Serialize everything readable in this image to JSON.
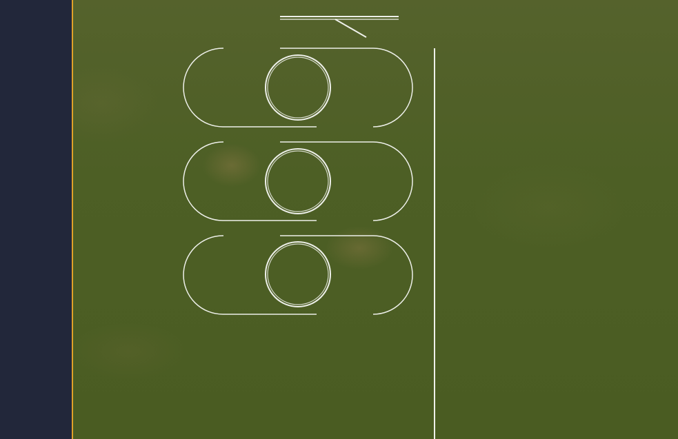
{
  "colors": {
    "sidebar": "#22273a",
    "accent_divider": "#e0a12a",
    "field": "#4d5f25",
    "markings": "#eef0ea"
  },
  "markings": {
    "oval_slots": 3,
    "icons": [
      "toggle-oval",
      "ring",
      "pointer-line",
      "vertical-guide"
    ]
  }
}
